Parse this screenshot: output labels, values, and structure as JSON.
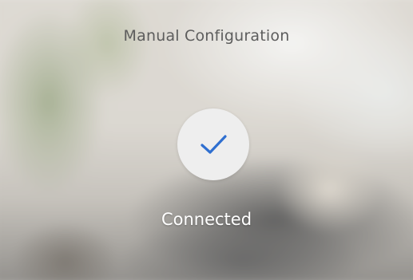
{
  "header": {
    "title": "Manual Configuration"
  },
  "status": {
    "icon": "checkmark-icon",
    "label": "Connected",
    "icon_color": "#2f6fd0",
    "badge_color": "#eeeeee"
  }
}
